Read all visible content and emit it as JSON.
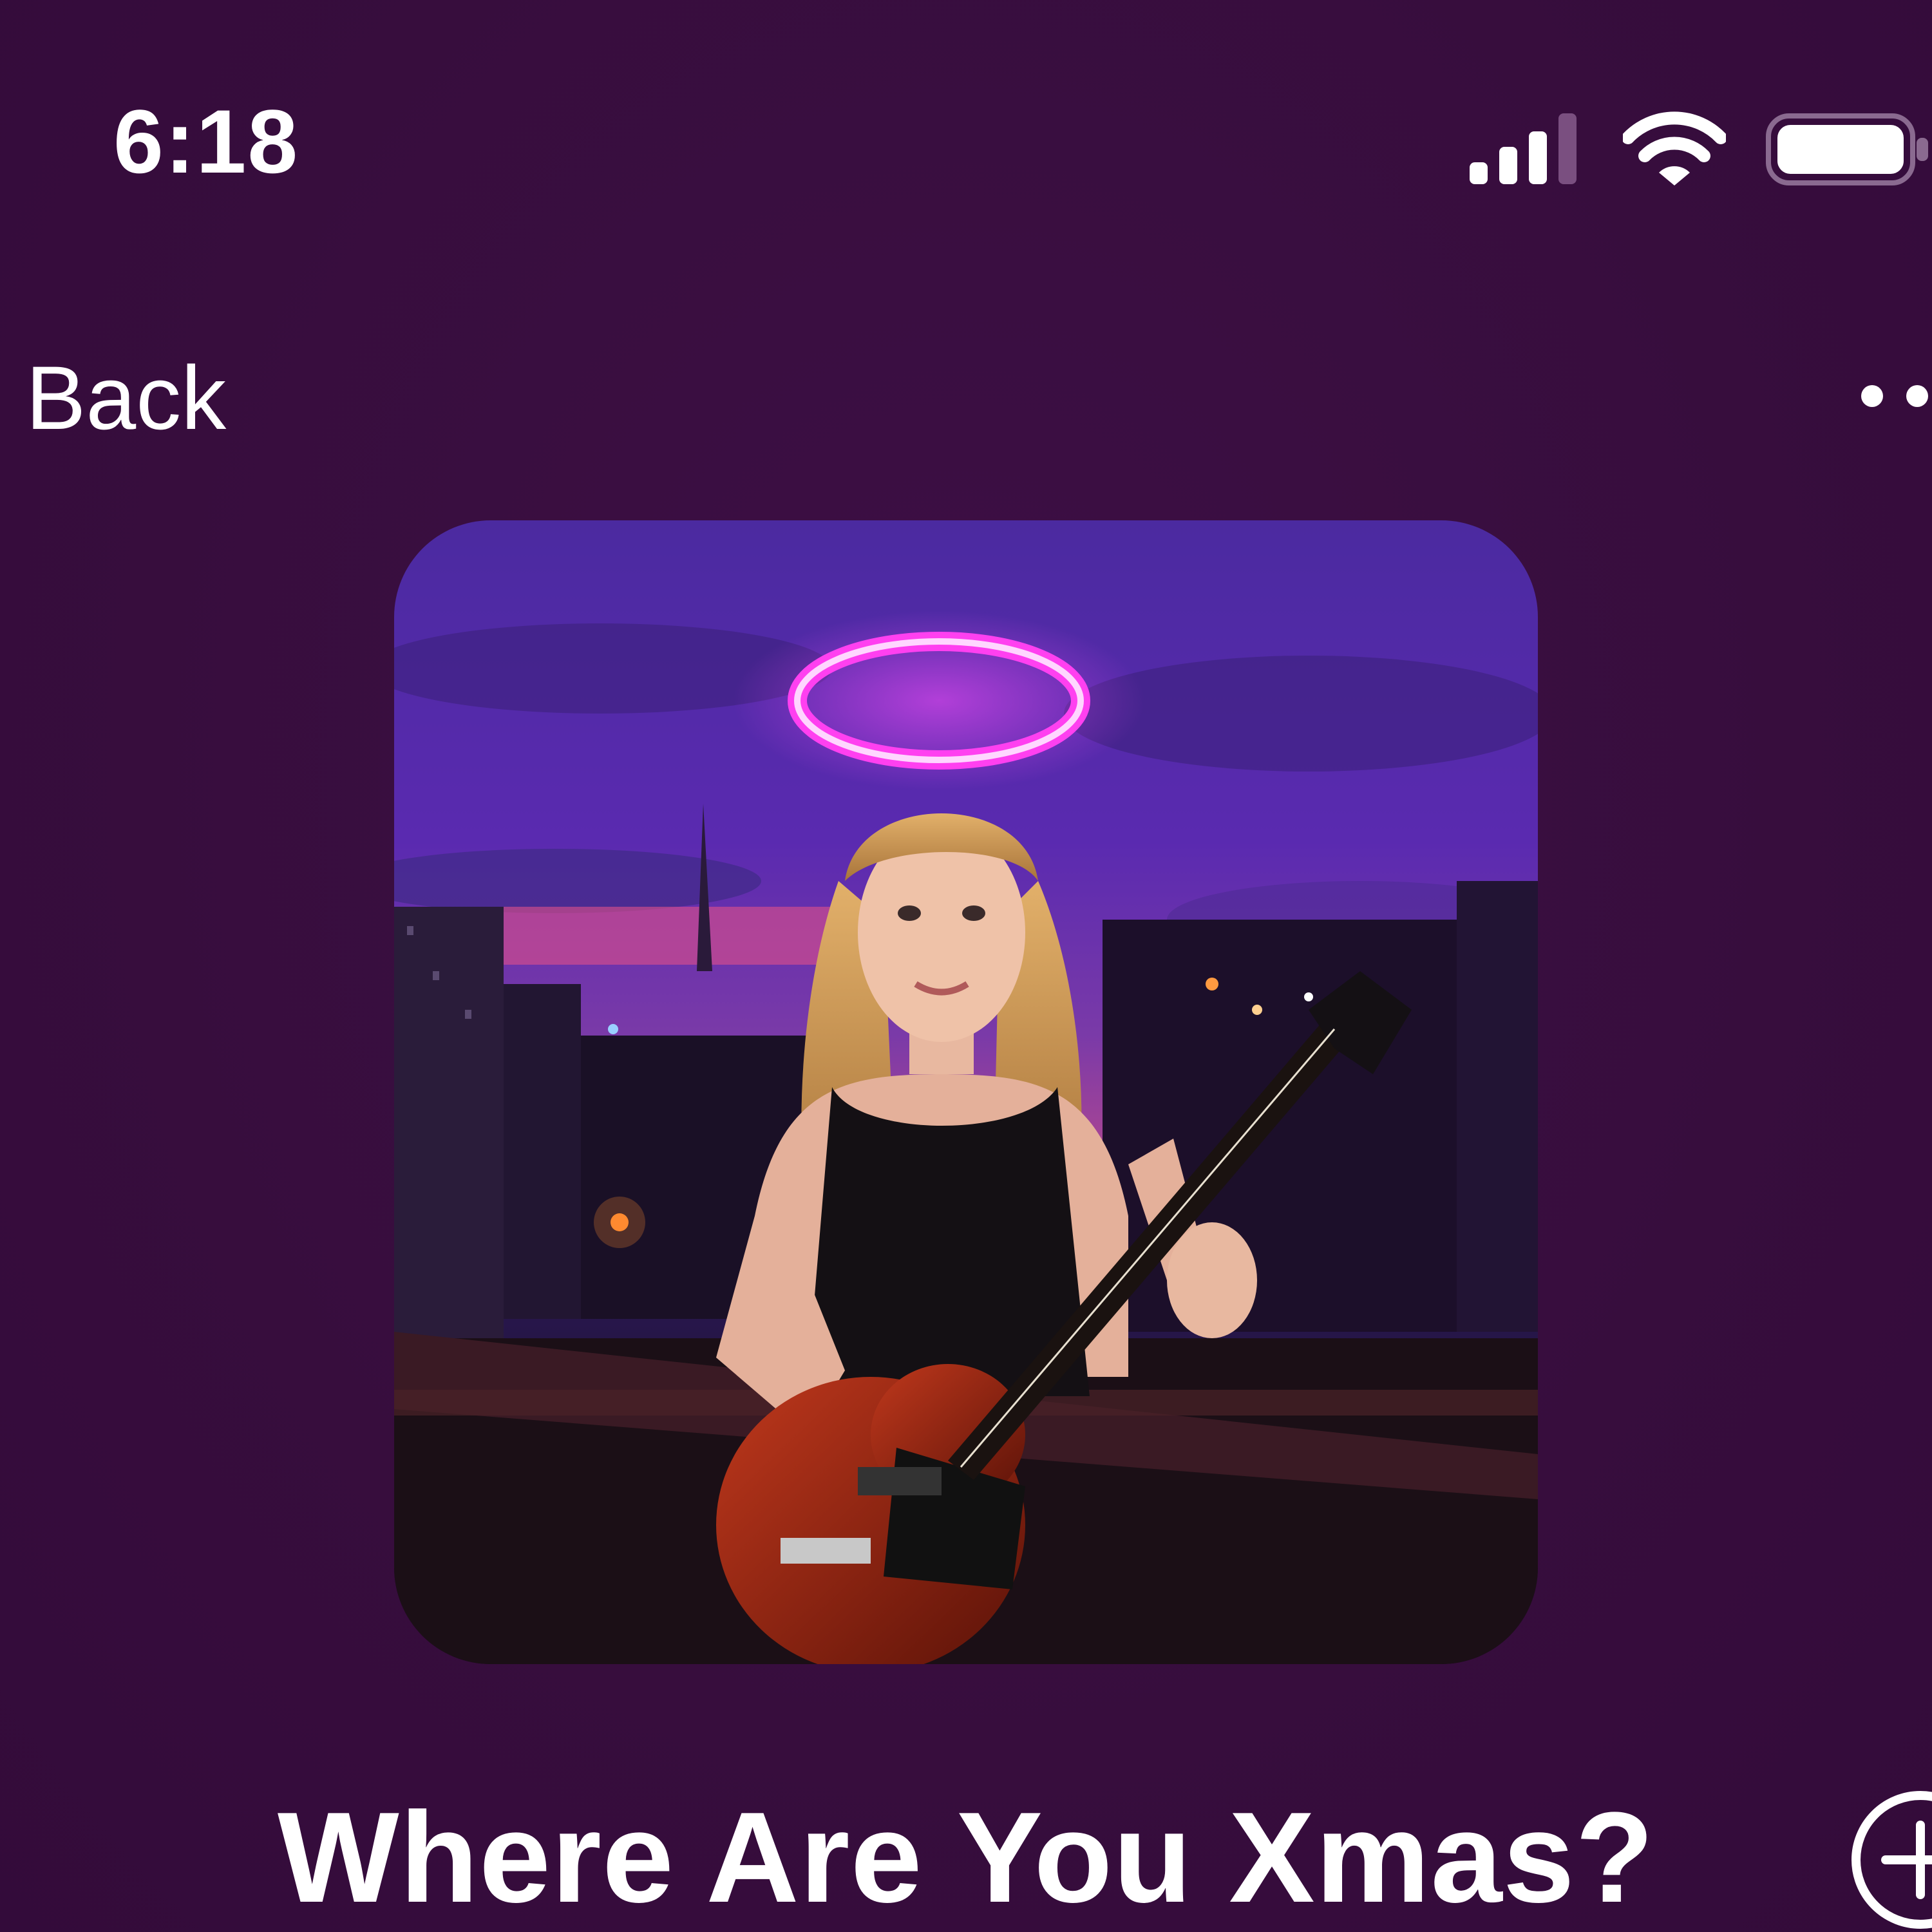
{
  "status_bar": {
    "time": "6:18",
    "signal_icon": "cellular-signal-icon",
    "wifi_icon": "wifi-icon",
    "battery_icon": "battery-icon"
  },
  "nav": {
    "back_label": "Back",
    "more_icon": "more-icon"
  },
  "artwork": {
    "icon": "album-artwork"
  },
  "song": {
    "title": "Where Are You Xmas?",
    "add_icon": "add-circle-icon"
  },
  "colors": {
    "background": "#3a0f40",
    "text": "#ffffff",
    "halo": "#ff3cf0"
  }
}
